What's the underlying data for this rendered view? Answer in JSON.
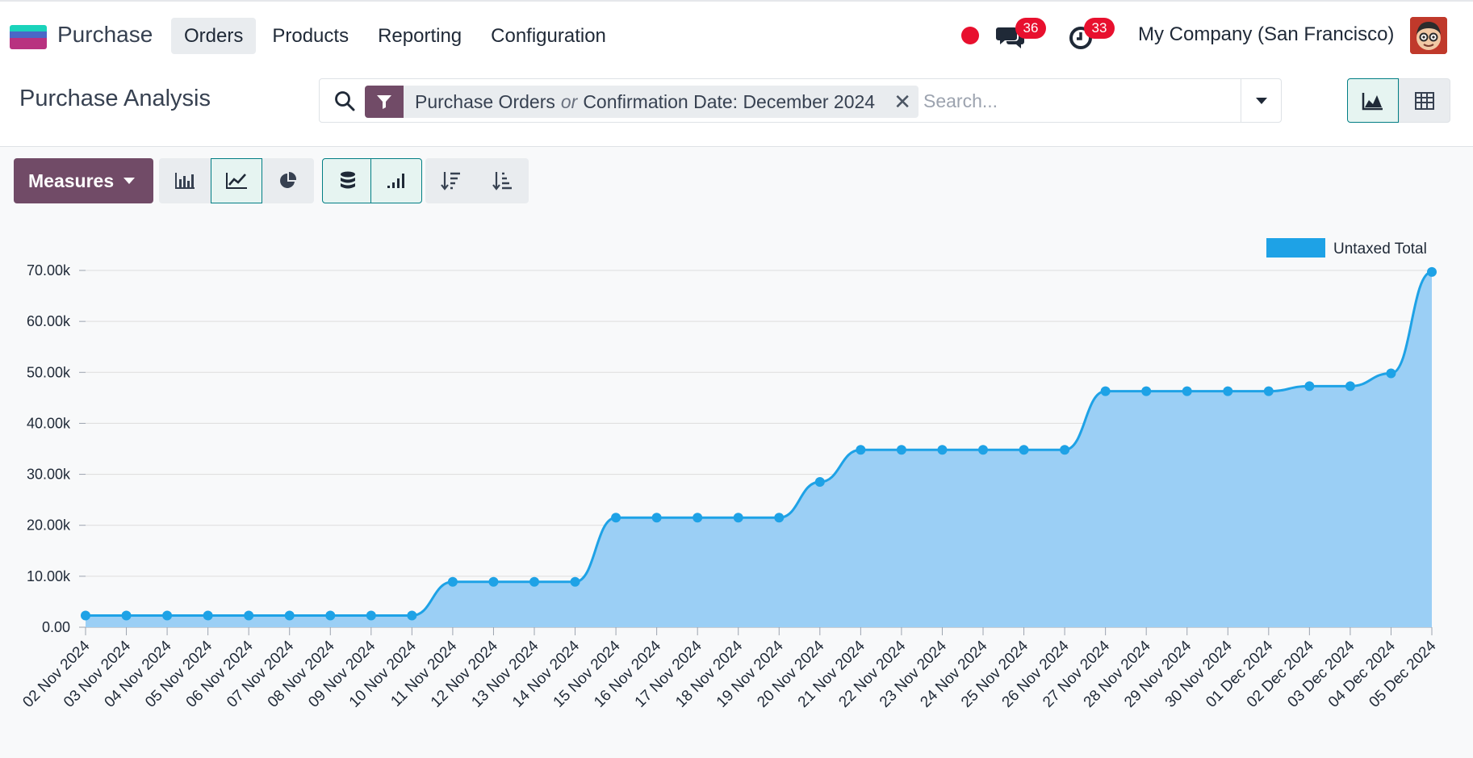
{
  "app": {
    "name": "Purchase",
    "logo_colors": [
      "#1ad3bb",
      "#4a68c7",
      "#b83280"
    ]
  },
  "nav": [
    {
      "label": "Orders",
      "active": true
    },
    {
      "label": "Products",
      "active": false
    },
    {
      "label": "Reporting",
      "active": false
    },
    {
      "label": "Configuration",
      "active": false
    }
  ],
  "systray": {
    "messages_count": "36",
    "activities_count": "33",
    "company": "My Company (San Francisco)",
    "icons": [
      "record-dot-icon",
      "chat-bubbles-icon",
      "activity-clock-icon",
      "user-avatar"
    ]
  },
  "control": {
    "page_title": "Purchase Analysis",
    "facet": {
      "icon": "filter-icon",
      "part1": "Purchase Orders",
      "or": "or",
      "part2": "Confirmation Date: December 2024"
    },
    "search_placeholder": "Search...",
    "views": [
      {
        "icon": "graph-view-icon",
        "active": true
      },
      {
        "icon": "pivot-view-icon",
        "active": false
      }
    ]
  },
  "toolbar": {
    "measures_label": "Measures",
    "buttons": [
      {
        "icon": "bar-chart-icon",
        "active": false
      },
      {
        "icon": "line-chart-icon",
        "active": true
      },
      {
        "icon": "pie-chart-icon",
        "active": false
      },
      {
        "icon": "stacked-icon",
        "active": true
      },
      {
        "icon": "cumulative-icon",
        "active": true
      },
      {
        "icon": "sort-descending-icon",
        "active": false
      },
      {
        "icon": "sort-ascending-icon",
        "active": false
      }
    ]
  },
  "colors": {
    "accent": "#714b67",
    "line": "#1ea2e6",
    "area": "#9bcff5",
    "badge": "#e8102e",
    "active_border": "#017e84"
  },
  "chart_data": {
    "type": "area",
    "title": "",
    "xlabel": "",
    "ylabel": "",
    "ylim": [
      0,
      70000
    ],
    "yticks": [
      "0.00",
      "10.00k",
      "20.00k",
      "30.00k",
      "40.00k",
      "50.00k",
      "60.00k",
      "70.00k"
    ],
    "grid": true,
    "legend_position": "top-right",
    "categories": [
      "02 Nov 2024",
      "03 Nov 2024",
      "04 Nov 2024",
      "05 Nov 2024",
      "06 Nov 2024",
      "07 Nov 2024",
      "08 Nov 2024",
      "09 Nov 2024",
      "10 Nov 2024",
      "11 Nov 2024",
      "12 Nov 2024",
      "13 Nov 2024",
      "14 Nov 2024",
      "15 Nov 2024",
      "16 Nov 2024",
      "17 Nov 2024",
      "18 Nov 2024",
      "19 Nov 2024",
      "20 Nov 2024",
      "21 Nov 2024",
      "22 Nov 2024",
      "23 Nov 2024",
      "24 Nov 2024",
      "25 Nov 2024",
      "26 Nov 2024",
      "27 Nov 2024",
      "28 Nov 2024",
      "29 Nov 2024",
      "30 Nov 2024",
      "01 Dec 2024",
      "02 Dec 2024",
      "03 Dec 2024",
      "04 Dec 2024",
      "05 Dec 2024"
    ],
    "series": [
      {
        "name": "Untaxed Total",
        "values": [
          2300,
          2300,
          2300,
          2300,
          2300,
          2300,
          2300,
          2300,
          2300,
          8900,
          8900,
          8900,
          8900,
          21500,
          21500,
          21500,
          21500,
          21500,
          28500,
          34800,
          34800,
          34800,
          34800,
          34800,
          34800,
          46300,
          46300,
          46300,
          46300,
          46300,
          47300,
          47300,
          49800,
          69700
        ]
      }
    ]
  }
}
